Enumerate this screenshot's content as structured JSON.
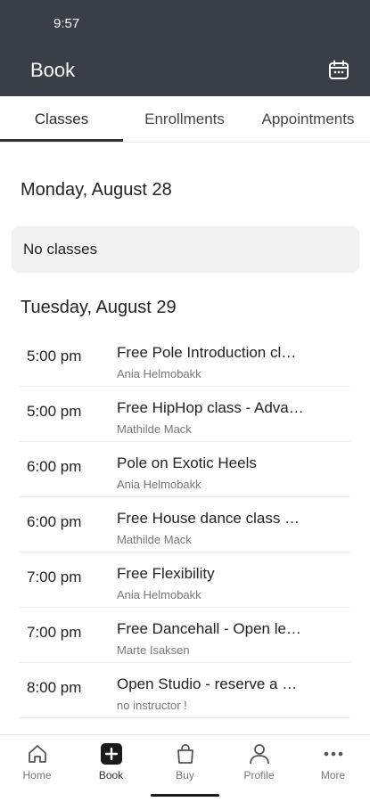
{
  "status": {
    "time": "9:57"
  },
  "header": {
    "title": "Book",
    "icon": "calendar-icon"
  },
  "tabs": [
    {
      "label": "Classes",
      "active": true
    },
    {
      "label": "Enrollments",
      "active": false
    },
    {
      "label": "Appointments",
      "active": false
    }
  ],
  "days": [
    {
      "date": "Monday, August 28",
      "empty_text": "No classes"
    },
    {
      "date": "Tuesday, August 29"
    }
  ],
  "classes": [
    {
      "time": "5:00 pm",
      "title": "Free Pole Introduction cl…",
      "instructor": "Ania Helmobakk"
    },
    {
      "time": "5:00 pm",
      "title": "Free HipHop class - Adva…",
      "instructor": "Mathilde Mack"
    },
    {
      "time": "6:00 pm",
      "title": "Pole on Exotic Heels",
      "instructor": "Ania Helmobakk"
    },
    {
      "time": "6:00 pm",
      "title": "Free House dance class …",
      "instructor": "Mathilde Mack"
    },
    {
      "time": "7:00 pm",
      "title": "Free Flexibility",
      "instructor": "Ania Helmobakk"
    },
    {
      "time": "7:00 pm",
      "title": "Free Dancehall - Open le…",
      "instructor": "Marte Isaksen"
    },
    {
      "time": "8:00 pm",
      "title": "Open Studio - reserve a …",
      "instructor": "no instructor !"
    }
  ],
  "bottom_nav": [
    {
      "label": "Home",
      "icon": "home-icon"
    },
    {
      "label": "Book",
      "icon": "plus-square-icon",
      "active": true
    },
    {
      "label": "Buy",
      "icon": "shopping-bag-icon"
    },
    {
      "label": "Profile",
      "icon": "person-icon"
    },
    {
      "label": "More",
      "icon": "more-dots-icon"
    }
  ],
  "colors": {
    "header_bg": "#3a3f47",
    "tab_indicator": "#2f3237",
    "empty_card_bg": "#f2f2f2"
  }
}
